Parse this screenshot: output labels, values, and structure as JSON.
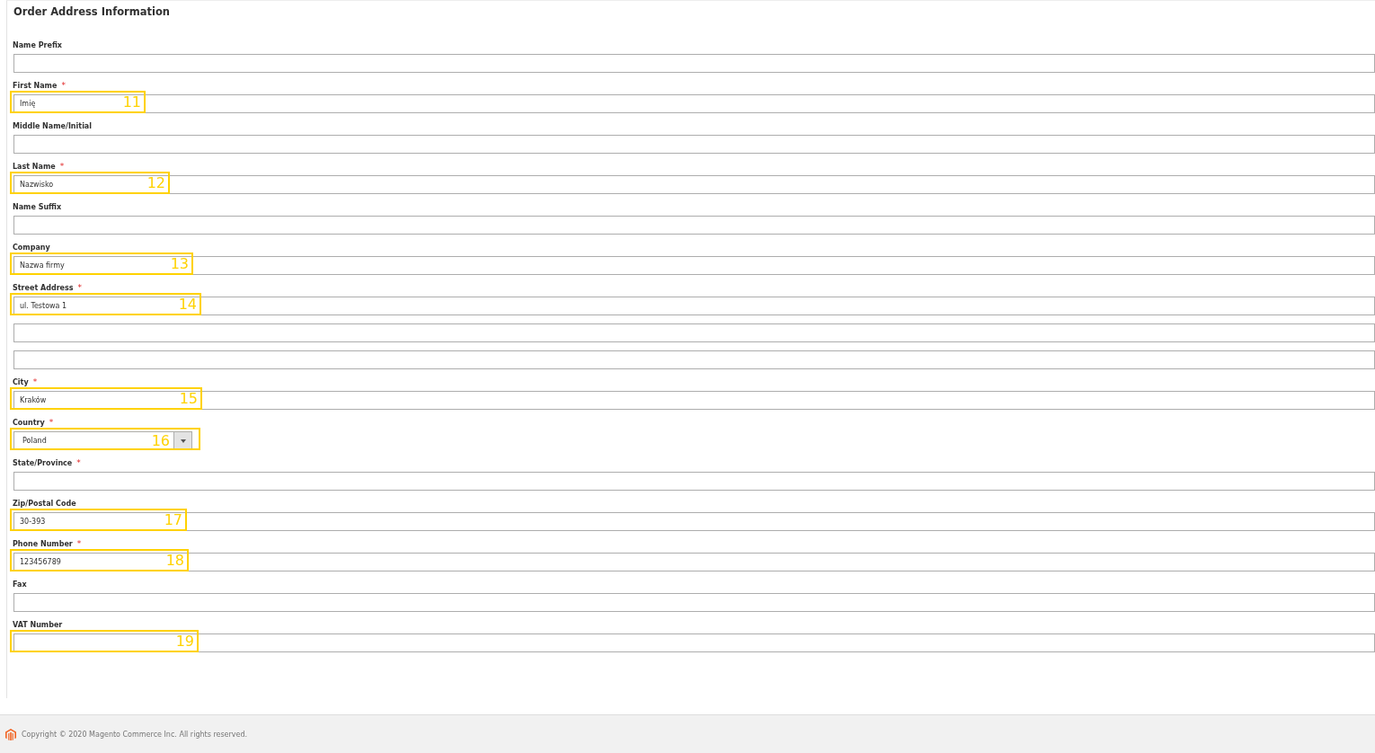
{
  "section": {
    "title": "Order Address Information"
  },
  "required_marker": "*",
  "fields": [
    {
      "label": "Name Prefix",
      "required": false,
      "inputs": [
        {
          "kind": "text"
        }
      ]
    },
    {
      "label": "First Name",
      "required": true,
      "inputs": [
        {
          "kind": "text",
          "value": "Imię"
        }
      ],
      "callout": "11"
    },
    {
      "label": "Middle Name/Initial",
      "required": false,
      "inputs": [
        {
          "kind": "text"
        }
      ]
    },
    {
      "label": "Last Name",
      "required": true,
      "inputs": [
        {
          "kind": "text",
          "value": "Nazwisko"
        }
      ],
      "callout": "12"
    },
    {
      "label": "Name Suffix",
      "required": false,
      "inputs": [
        {
          "kind": "text"
        }
      ]
    },
    {
      "label": "Company",
      "required": false,
      "inputs": [
        {
          "kind": "text",
          "value": "Nazwa firmy"
        }
      ],
      "callout": "13"
    },
    {
      "label": "Street Address",
      "required": true,
      "inputs": [
        {
          "kind": "text",
          "value": "ul. Testowa 1"
        },
        {
          "kind": "text"
        },
        {
          "kind": "text"
        }
      ],
      "callout": "14"
    },
    {
      "label": "City",
      "required": true,
      "inputs": [
        {
          "kind": "text",
          "value": "Kraków"
        }
      ],
      "callout": "15"
    },
    {
      "label": "Country",
      "required": true,
      "inputs": [
        {
          "kind": "select",
          "value": "Poland"
        }
      ],
      "callout": "16"
    },
    {
      "label": "State/Province",
      "required": true,
      "inputs": [
        {
          "kind": "text"
        }
      ]
    },
    {
      "label": "Zip/Postal Code",
      "required": false,
      "inputs": [
        {
          "kind": "text",
          "value": "30-393"
        }
      ],
      "callout": "17"
    },
    {
      "label": "Phone Number",
      "required": true,
      "inputs": [
        {
          "kind": "text",
          "value": "123456789"
        }
      ],
      "callout": "18"
    },
    {
      "label": "Fax",
      "required": false,
      "inputs": [
        {
          "kind": "text"
        }
      ]
    },
    {
      "label": "VAT Number",
      "required": false,
      "inputs": [
        {
          "kind": "text"
        }
      ],
      "callout": "19"
    }
  ],
  "footer": {
    "copyright": "Copyright © 2020 Magento Commerce Inc. All rights reserved."
  }
}
